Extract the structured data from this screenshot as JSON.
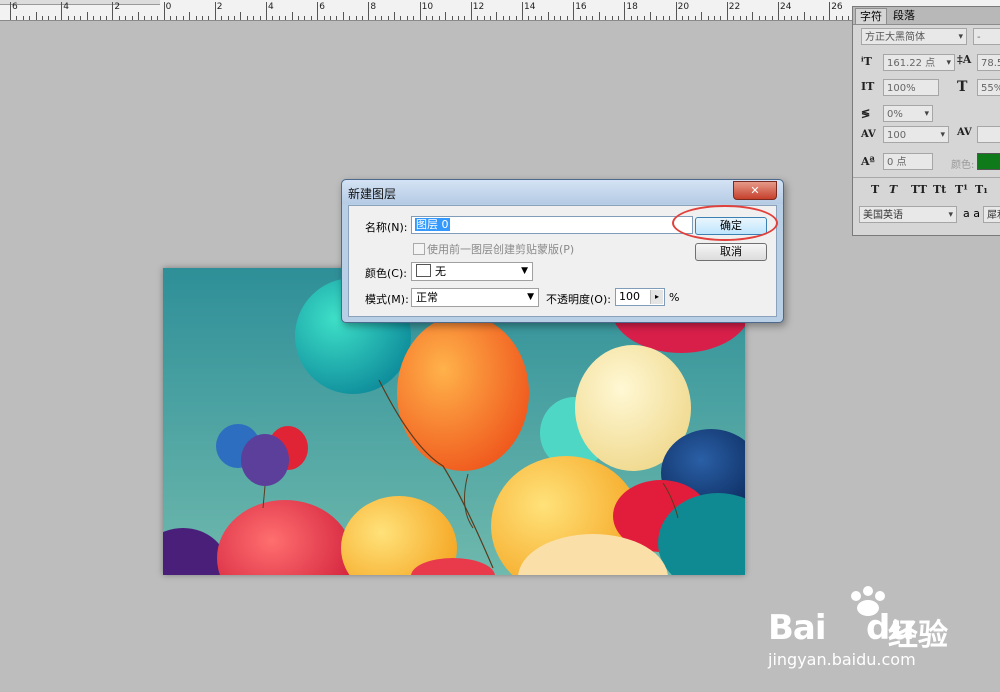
{
  "ruler": {
    "labels": [
      "6",
      "4",
      "2",
      "0",
      "2",
      "4",
      "6",
      "8",
      "10",
      "12",
      "14",
      "16",
      "18",
      "20",
      "22",
      "24",
      "26"
    ]
  },
  "character_panel": {
    "tabs": [
      "字符",
      "段落"
    ],
    "font_family": "方正大黑简体",
    "font_style": "-",
    "font_size": "161.22 点",
    "leading": "78.5",
    "vertical_scale": "100%",
    "horizontal_scale": "55%",
    "tsume": "0%",
    "tracking": "100",
    "baseline_shift": "0 点",
    "color_label": "颜色:",
    "color": "#0f7a1a",
    "style_buttons": [
      "T",
      "T",
      "TT",
      "Tt",
      "T¹",
      "T₁"
    ],
    "language": "美国英语",
    "aa_label": "a a",
    "antialias": "犀利"
  },
  "dialog": {
    "title": "新建图层",
    "close_label": "✕",
    "name_label": "名称(N):",
    "name_value": "图层 0",
    "clipping_mask_label": "使用前一图层创建剪贴蒙版(P)",
    "color_label": "颜色(C):",
    "color_value": "无",
    "mode_label": "模式(M):",
    "mode_value": "正常",
    "opacity_label": "不透明度(O):",
    "opacity_value": "100",
    "opacity_unit": "%",
    "ok_label": "确定",
    "cancel_label": "取消",
    "highlight_color": "#e0413c"
  },
  "watermark": {
    "brand_bai": "Bai",
    "brand_du": "du",
    "brand_exp": "经验",
    "url": "jingyan.baidu.com"
  }
}
